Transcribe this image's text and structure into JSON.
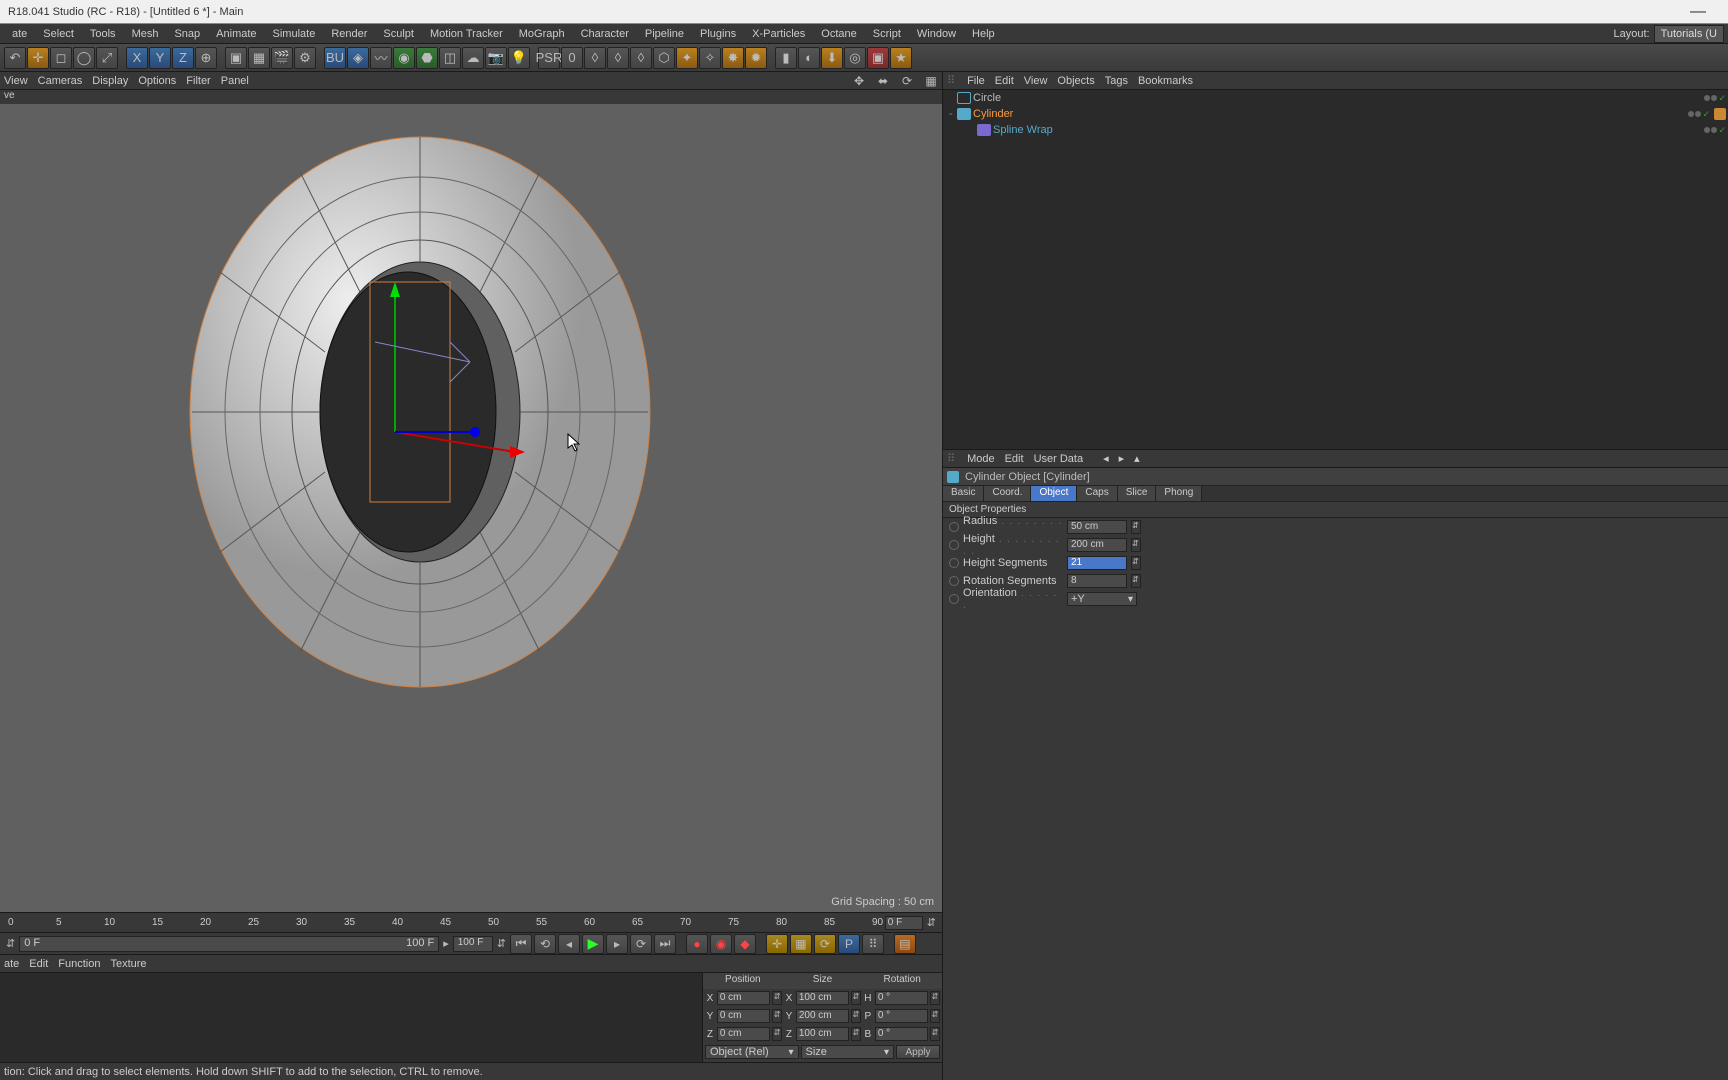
{
  "window": {
    "title": "R18.041 Studio (RC - R18) - [Untitled 6 *] - Main"
  },
  "main_menu": [
    "ate",
    "Select",
    "Tools",
    "Mesh",
    "Snap",
    "Animate",
    "Simulate",
    "Render",
    "Sculpt",
    "Motion Tracker",
    "MoGraph",
    "Character",
    "Pipeline",
    "Plugins",
    "X-Particles",
    "Octane",
    "Script",
    "Window",
    "Help"
  ],
  "layout": {
    "label": "Layout:",
    "value": "Tutorials (U"
  },
  "viewport_menu": [
    "View",
    "Cameras",
    "Display",
    "Options",
    "Filter",
    "Panel"
  ],
  "viewport_label": "ve",
  "grid_spacing": "Grid Spacing : 50 cm",
  "timeline": {
    "ticks": [
      "0",
      "5",
      "10",
      "15",
      "20",
      "25",
      "30",
      "35",
      "40",
      "45",
      "50",
      "55",
      "60",
      "65",
      "70",
      "75",
      "80",
      "85",
      "90"
    ],
    "end_field": "0 F",
    "range_start": "0 F",
    "range_end": "100 F",
    "range_end2": "100 F"
  },
  "material_menu": [
    "ate",
    "Edit",
    "Function",
    "Texture"
  ],
  "coords": {
    "headers": [
      "Position",
      "Size",
      "Rotation"
    ],
    "rows": [
      {
        "axis": "X",
        "pos": "0 cm",
        "size": "100 cm",
        "rotlab": "H",
        "rot": "0 °"
      },
      {
        "axis": "Y",
        "pos": "0 cm",
        "size": "200 cm",
        "rotlab": "P",
        "rot": "0 °"
      },
      {
        "axis": "Z",
        "pos": "0 cm",
        "size": "100 cm",
        "rotlab": "B",
        "rot": "0 °"
      }
    ],
    "mode": "Object (Rel)",
    "sizemode": "Size",
    "apply": "Apply"
  },
  "status_hint": "tion: Click and drag to select elements. Hold down SHIFT to add to the selection, CTRL to remove.",
  "obj_menu": [
    "File",
    "Edit",
    "View",
    "Objects",
    "Tags",
    "Bookmarks"
  ],
  "tree": [
    {
      "name": "Circle",
      "sel": false,
      "indent": 0,
      "icon": "circle",
      "tags": []
    },
    {
      "name": "Cylinder",
      "sel": true,
      "indent": 0,
      "icon": "cyl",
      "expand": "-",
      "tags": [
        "phong"
      ]
    },
    {
      "name": "Spline Wrap",
      "sel": false,
      "indent": 1,
      "icon": "wrap",
      "teal": true,
      "tags": []
    }
  ],
  "attr_menu": [
    "Mode",
    "Edit",
    "User Data"
  ],
  "attr_title": "Cylinder Object [Cylinder]",
  "tabs": [
    "Basic",
    "Coord.",
    "Object",
    "Caps",
    "Slice",
    "Phong"
  ],
  "active_tab": "Object",
  "section": "Object Properties",
  "props": [
    {
      "label": "Radius",
      "value": "50 cm",
      "type": "num"
    },
    {
      "label": "Height",
      "value": "200 cm",
      "type": "num"
    },
    {
      "label": "Height Segments",
      "value": "21",
      "type": "num",
      "sel": true
    },
    {
      "label": "Rotation Segments",
      "value": "8",
      "type": "num"
    },
    {
      "label": "Orientation",
      "value": "+Y",
      "type": "dd"
    }
  ]
}
